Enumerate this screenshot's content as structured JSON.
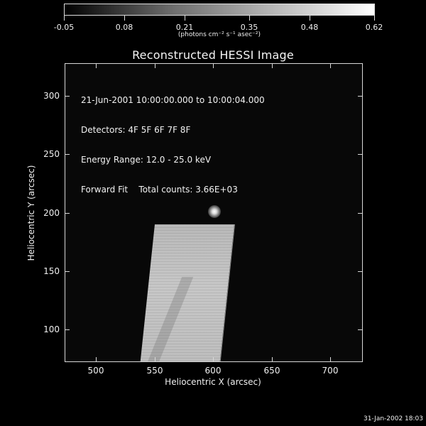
{
  "colorbar": {
    "tick_labels": [
      "-0.05",
      "0.08",
      "0.21",
      "0.35",
      "0.48",
      "0.62"
    ],
    "tick_values": [
      -0.05,
      0.08,
      0.21,
      0.35,
      0.48,
      0.62
    ],
    "range": [
      -0.05,
      0.62
    ],
    "unit_label": "(photons cm⁻² s⁻¹ asec⁻²)"
  },
  "title": "Reconstructed HESSI Image",
  "info": {
    "time_range": "21-Jun-2001 10:00:00.000 to 10:00:04.000",
    "detectors": "Detectors: 4F 5F 6F 7F 8F",
    "energy_range": "Energy Range: 12.0 - 25.0 keV",
    "method": "Forward Fit    Total counts: 3.66E+03"
  },
  "axes": {
    "x_title": "Heliocentric X (arcsec)",
    "y_title": "Heliocentric Y (arcsec)",
    "x_ticks": [
      "500",
      "550",
      "600",
      "650",
      "700"
    ],
    "x_tick_values": [
      500,
      550,
      600,
      650,
      700
    ],
    "x_range": [
      473,
      728
    ],
    "y_ticks": [
      "100",
      "150",
      "200",
      "250",
      "300"
    ],
    "y_tick_values": [
      100,
      150,
      200,
      250,
      300
    ],
    "y_range": [
      72,
      328
    ]
  },
  "timestamp": "31-Jan-2002 18:03"
}
